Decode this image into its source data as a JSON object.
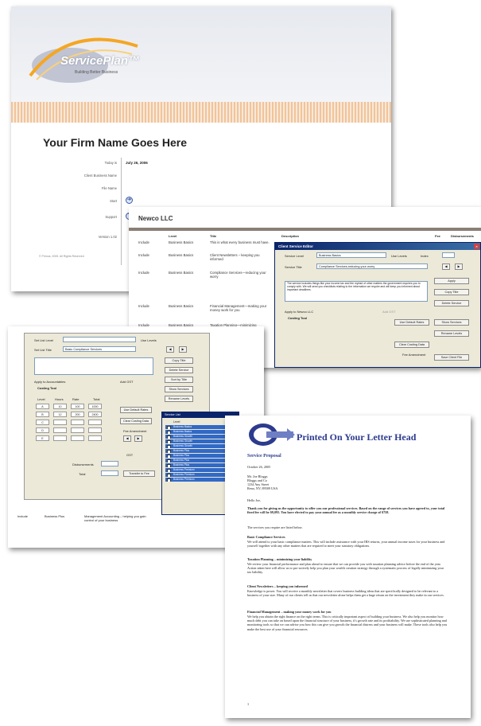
{
  "cover": {
    "logo_text": "ServicePlan™",
    "logo_tagline": "Building Better Business",
    "firm_name": "Your Firm Name Goes Here",
    "labels": [
      "Today is",
      "Client Business Name",
      "File Name",
      "Start",
      "Support",
      "Version 1.02"
    ],
    "date_value": "July 26, 2006",
    "copyright": "© Primus, 2005. All Rights Reserved"
  },
  "newco": {
    "title": "Newco LLC",
    "headers": [
      "Level",
      "Title",
      "Description",
      "Fee",
      "Disbursements"
    ],
    "rows": [
      {
        "inc": "Include",
        "level": "Business Basics",
        "title": "This is what every business must have."
      },
      {
        "inc": "Include",
        "level": "Business Basics",
        "title": "Client Newsletters – keeping you informed"
      },
      {
        "inc": "Include",
        "level": "Business Basics",
        "title": "Compliance Services—reducing your worry"
      },
      {
        "inc": "Include",
        "level": "Business Basics",
        "title": "Financial Management—making your money work for you"
      },
      {
        "inc": "Include",
        "level": "Business Basics",
        "title": "Taxation Planning—minimizing"
      }
    ]
  },
  "editor": {
    "title": "Client Service Editor",
    "service_level_label": "Service Level",
    "service_level_value": "Business Basics",
    "use_levels": "Use Levels",
    "index_label": "Index",
    "service_title_label": "Service Title",
    "service_title_value": "Compliance Services-reducing your worry",
    "description": "The service includes things like your income tax and the myriad of other matters the government requires you to comply with. We will send you checklists relating to the information we require and will keep you informed about important deadlines.",
    "apply_label": "Apply to Newco LLC",
    "costing_tool": "Costing Tool",
    "buttons": [
      "Apply",
      "Copy Title",
      "Delete Service",
      "Use Default Rates",
      "Clear Costing Data",
      "Show Services",
      "Rename Levels",
      "Save Client File"
    ],
    "fee_amendment": "Fee Amendment",
    "default_fee": "Default Fee",
    "gst": "GST",
    "add_gst": "Add GST"
  },
  "levels": {
    "set_list_level": "Set List Level",
    "set_list_title": "Set List Title",
    "title_value": "Basic Compliance Services",
    "use_levels": "Use Levels",
    "buttons": [
      "Copy Title",
      "Delete Service",
      "Sort by Title",
      "Show Services",
      "Rename Levels",
      "Use Default Rates",
      "Clear Costing Data",
      "Transfer to Fee"
    ],
    "apply_label": "Apply to Accountables",
    "add_gst": "Add GST",
    "costing_tool": "Costing Tool",
    "col_heads": [
      "Level",
      "Hours",
      "Rate",
      "Total"
    ],
    "grid": [
      [
        "A",
        "10",
        "100",
        "1000"
      ],
      [
        "B",
        "12",
        "200",
        "2400"
      ],
      [
        "C",
        "",
        "",
        ""
      ],
      [
        "D",
        "",
        "",
        ""
      ],
      [
        "E",
        "",
        "",
        ""
      ]
    ],
    "fee_amendment": "Fee Amendment",
    "gst": "GST",
    "disbursements": "Disbursements",
    "total": "Total",
    "dis_ok": "Disbursements"
  },
  "slist": {
    "title": "Service List",
    "rows": [
      "Business Basics",
      "Business Basics",
      "Business Growth",
      "Business Growth",
      "Business Growth",
      "Business Plus",
      "Business Plus",
      "Business Plus",
      "Business Plus",
      "Business Premium",
      "Business Premium",
      "Business Premium"
    ],
    "level_head": "Level",
    "ok": "OK"
  },
  "left_rows": [
    {
      "inc": "Include",
      "level": "Business Plus",
      "title": "Management Accounting – helping you gain control of your business"
    }
  ],
  "letter": {
    "letterhead": "Printed On Your Letter Head",
    "title": "Service Proposal",
    "date": "October 26, 2005",
    "addr": [
      "Mr. Joe Bloggs",
      "Bloggs and Co",
      "1234 Any Street",
      "Reno, NV, 89509 USA"
    ],
    "greeting": "Hello Joe,",
    "intro": "Thank you for giving us the opportunity to offer you our professional services. Based on the range of services you have agreed to, your total fixed fee will be $9,095. You have elected to pay your annual fee as a monthly service charge of $758.",
    "list_intro": "The services you require are listed below.",
    "sections": [
      {
        "h": "Basic Compliance Services",
        "p": "We will attend to your basic compliance matters. This will include assistance with your IRS returns, your annual income taxes for your business and yourself together with any other matters that are required to meet your statutory obligations."
      },
      {
        "h": "Taxation Planning – minimizing your liability",
        "p": "We review your financial performance and plan ahead to ensure that we can provide you with taxation planning advice before the end of the year. Action taken here will allow us to pro-actively help you plan your wealth creation strategy through a systematic process of legally minimizing your tax liability."
      },
      {
        "h": "Client Newsletters – keeping you informed",
        "p": "Knowledge is power. You will receive a monthly newsletter that covers business building ideas that are specifically designed to be relevant to a business of your size. Many of our clients tell us that our newsletter alone helps them get a huge return on the investment they make in our services."
      },
      {
        "h": "Financial Management – making your money work for you",
        "p": "We help you obtain the right finance on the right terms. This is critically important aspect of building your business. We also help you monitor how much debt you can take on based upon the financial structure of your business, it's growth rate and its profitability. We use sophisticated planning and monitoring tools so that we can advise you how this can give you growth the financial distress and your business will make. These tools also help you make the best use of your financial resources."
      }
    ],
    "page_no": "1"
  },
  "colors": {
    "accent": "#2d3b8e",
    "titlebar": "#0a246a",
    "dialog_bg": "#ece9d8",
    "stripe": "#f0c49a"
  }
}
